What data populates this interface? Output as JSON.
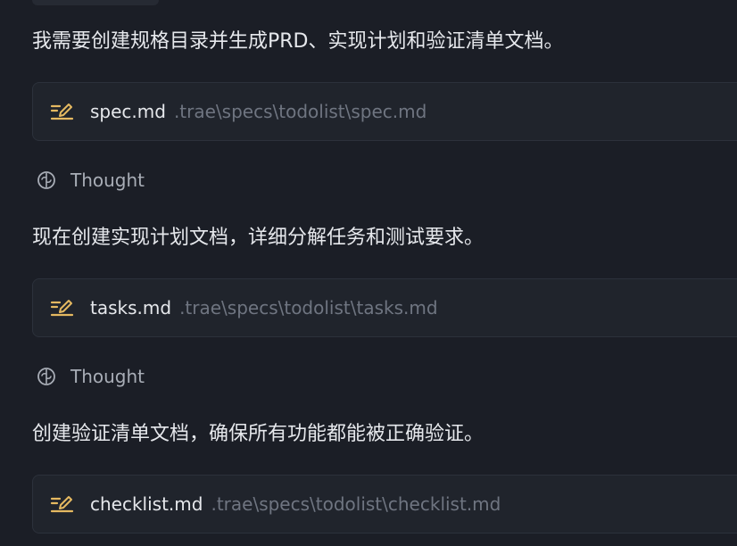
{
  "messages": [
    "我需要创建规格目录并生成PRD、实现计划和验证清单文档。",
    "现在创建实现计划文档，详细分解任务和测试要求。",
    "创建验证清单文档，确保所有功能都能被正确验证。"
  ],
  "files": [
    {
      "name": "spec.md",
      "path": ".trae\\specs\\todolist\\spec.md",
      "icon": "edit-file-icon"
    },
    {
      "name": "tasks.md",
      "path": ".trae\\specs\\todolist\\tasks.md",
      "icon": "edit-file-icon"
    },
    {
      "name": "checklist.md",
      "path": ".trae\\specs\\todolist\\checklist.md",
      "icon": "edit-file-icon"
    }
  ],
  "thoughts": [
    {
      "label": "Thought",
      "icon": "brain-icon"
    },
    {
      "label": "Thought",
      "icon": "brain-icon"
    }
  ],
  "colors": {
    "background": "#1b1e26",
    "card": "#20242c",
    "icon_accent": "#e5b961",
    "text_primary": "#e6e8ec",
    "text_muted": "#6f7581"
  }
}
